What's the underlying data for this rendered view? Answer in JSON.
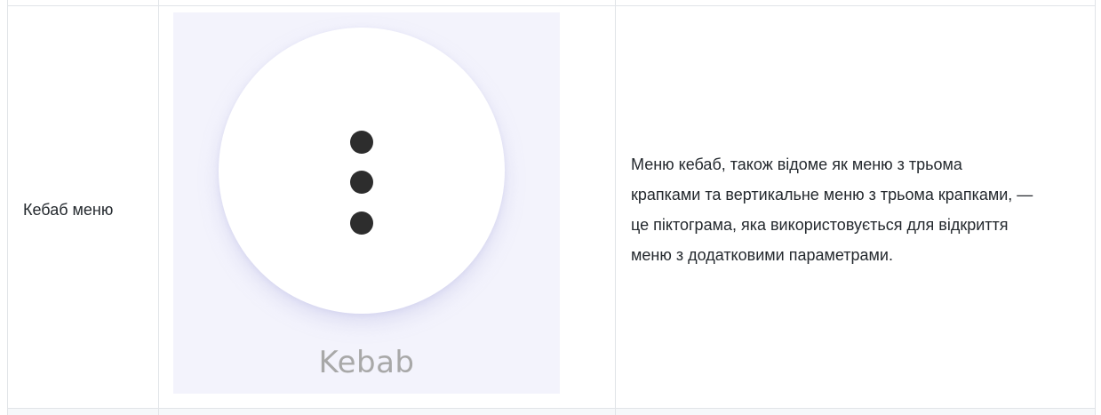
{
  "table": {
    "row": {
      "term": "Кебаб меню",
      "image": {
        "icon": "kebab-menu-icon",
        "caption": "Kebab"
      },
      "description_lines": [
        "Меню кебаб, також відоме як меню з трьома",
        "крапками та вертикальне меню з трьома крапками, —",
        "це піктограма, яка використовується для відкриття",
        "меню з додатковими параметрами."
      ]
    }
  },
  "colors": {
    "border": "#e1e4e8",
    "text": "#24292e",
    "image_background": "#f3f3fc",
    "dot": "#2d2d2d",
    "caption": "#a8a8a8"
  }
}
